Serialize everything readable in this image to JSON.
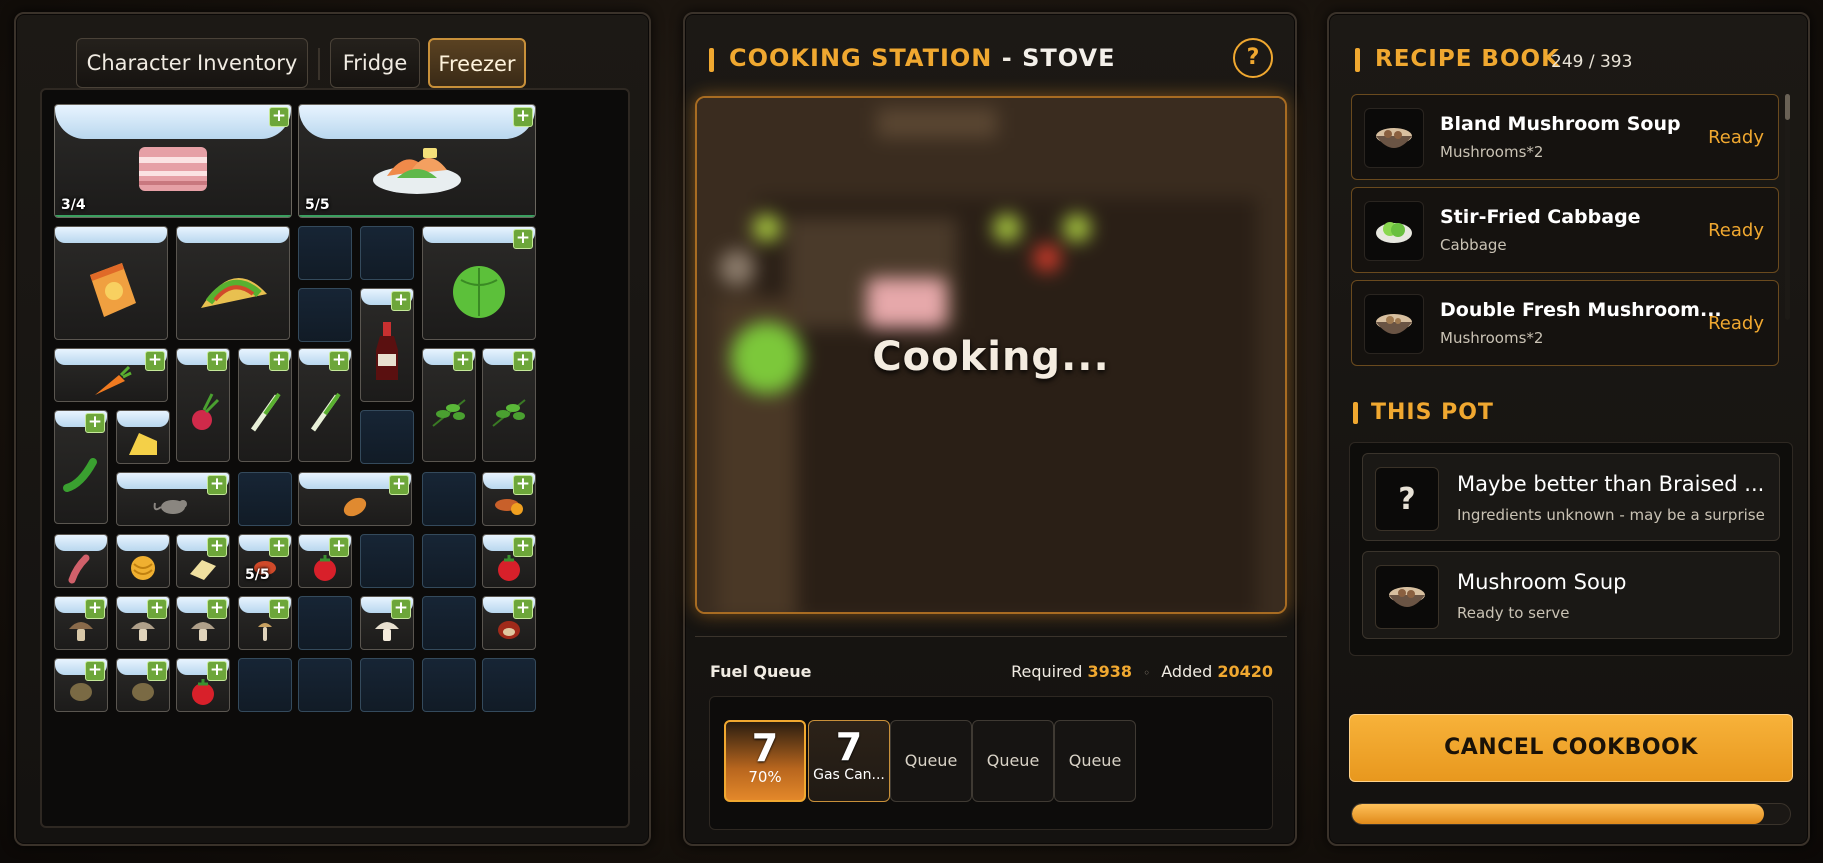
{
  "inventory": {
    "tabs": [
      {
        "label": "Character Inventory",
        "active": false
      },
      {
        "label": "Fridge",
        "active": false
      },
      {
        "label": "Freezer",
        "active": true
      }
    ],
    "counts": {
      "bacon": "3/4",
      "sashimi": "5/5",
      "steak_small": "5/5"
    },
    "items": [
      "bacon-icon",
      "sashimi-icon",
      "snack-bag-icon",
      "taco-icon",
      "cabbage-icon",
      "soy-sauce-icon",
      "carrot-icon",
      "radish-icon",
      "scallion-icon",
      "herb-icon",
      "green-pepper-icon",
      "cheese-icon",
      "mouse-icon",
      "bread-icon",
      "sweet-potato-icon",
      "sausage-icon",
      "noodles-icon",
      "tofu-icon",
      "tomato-icon",
      "mushroom-icon",
      "chestnut-icon",
      "potato-icon"
    ]
  },
  "cooking": {
    "title_main": "COOKING STATION",
    "title_dash": "-",
    "title_sub": "STOVE",
    "help_label": "?",
    "status_text": "Cooking...",
    "fuel": {
      "label": "Fuel Queue",
      "required_label": "Required",
      "required_value": "3938",
      "separator": "◦",
      "added_label": "Added",
      "added_value": "20420",
      "active_slot": {
        "count": "7",
        "percent_label": "70%"
      },
      "gas_slot": {
        "count": "7",
        "label": "Gas Can..."
      },
      "queue_labels": [
        "Queue",
        "Queue",
        "Queue"
      ]
    }
  },
  "recipe_book": {
    "title": "RECIPE BOOK",
    "count": "249 / 393",
    "recipes": [
      {
        "name": "Bland Mushroom Soup",
        "ingredients": "Mushrooms*2",
        "status": "Ready"
      },
      {
        "name": "Stir-Fried Cabbage",
        "ingredients": "Cabbage",
        "status": "Ready"
      },
      {
        "name": "Double Fresh Mushroom...",
        "ingredients": "Mushrooms*2",
        "status": "Ready"
      }
    ],
    "pot_title": "THIS POT",
    "pot_items": [
      {
        "name": "Maybe better than Braised ...",
        "detail": "Ingredients unknown - may be a surprise",
        "icon": "question-icon",
        "icon_label": "?"
      },
      {
        "name": "Mushroom Soup",
        "detail": "Ready to serve",
        "icon": "soup-bowl-icon"
      }
    ],
    "cancel_label": "CANCEL COOKBOOK",
    "progress": 0.94
  },
  "colors": {
    "accent": "#f0a830",
    "slot_empty": "#172535",
    "plus_green": "#6da63a"
  }
}
